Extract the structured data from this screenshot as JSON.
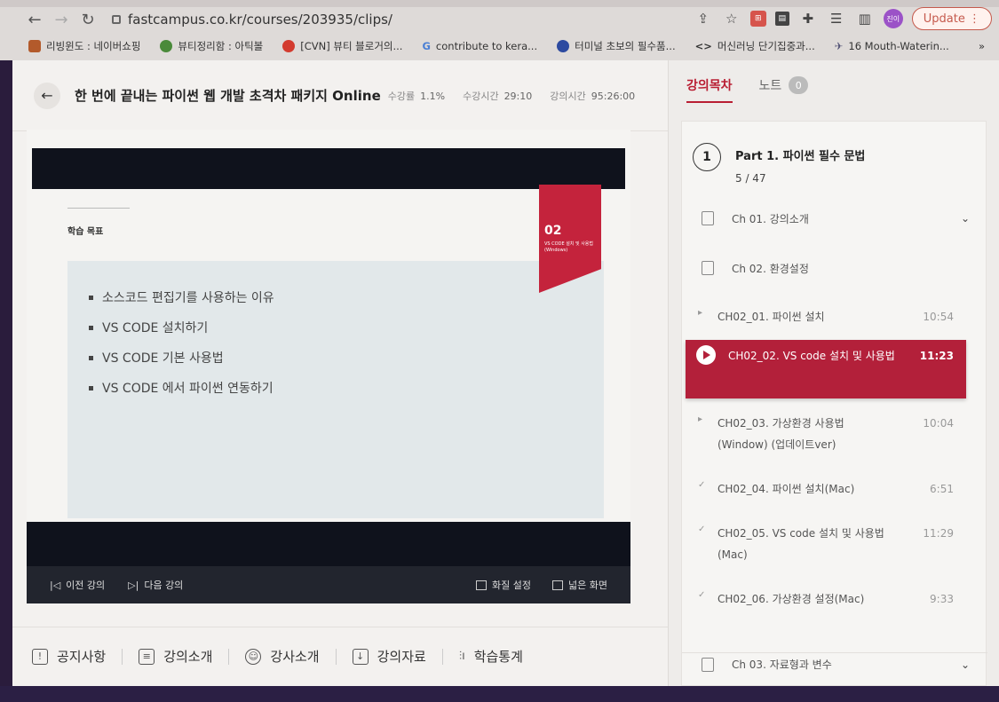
{
  "browser": {
    "url": "fastcampus.co.kr/courses/203935/clips/",
    "update_label": "Update",
    "profile_label": "진이",
    "bookmarks": [
      {
        "label": "리빙윈도 : 네이버쇼핑",
        "color": "#b35a2b"
      },
      {
        "label": "뷰티정리함 : 아틱볼",
        "color": "#4a8a3a"
      },
      {
        "label": "[CVN] 뷰티 블로거의...",
        "color": "#d33b2f"
      },
      {
        "label": "contribute to kera...",
        "color": "#4a7fd4"
      },
      {
        "label": "터미널 초보의 필수품...",
        "color": "#2d4aa0"
      },
      {
        "label": "머신러닝 단기집중과...",
        "color": "#444444"
      },
      {
        "label": "16 Mouth-Waterin...",
        "color": "#555577"
      }
    ]
  },
  "course": {
    "title": "한 번에 끝내는 파이썬 웹 개발 초격차 패키지 Online",
    "progress_label": "수강률",
    "progress_value": "1.1%",
    "watched_label": "수강시간",
    "watched_value": "29:10",
    "total_label": "강의시간",
    "total_value": "95:26:00"
  },
  "slide": {
    "goal_label": "학습 목표",
    "ribbon_num": "02",
    "ribbon_sub": "VS CODE 설치 및 사용법 (Windows)",
    "bullets": [
      "소스코드 편집기를 사용하는 이유",
      "VS CODE 설치하기",
      "VS CODE 기본 사용법",
      "VS CODE 에서 파이썬 연동하기"
    ]
  },
  "controls": {
    "prev": "이전 강의",
    "next": "다음 강의",
    "quality": "화질 설정",
    "wide": "넓은 화면"
  },
  "bottom_tabs": [
    "공지사항",
    "강의소개",
    "강사소개",
    "강의자료",
    "학습통계"
  ],
  "sidebar": {
    "tab_toc": "강의목차",
    "tab_notes": "노트",
    "notes_count": "0",
    "part_number": "1",
    "part_title": "Part 1. 파이썬 필수 문법",
    "part_progress": "5 / 47",
    "chapters": [
      "Ch 01. 강의소개",
      "Ch 02. 환경설정",
      "Ch 03. 자료형과 변수"
    ],
    "lectures": [
      {
        "name": "CH02_01. 파이썬 설치",
        "duration": "10:54"
      },
      {
        "name": "CH02_02. VS code 설치 및 사용법",
        "duration": "11:23"
      },
      {
        "name": "CH02_03. 가상환경 사용법 (Window) (업데이트ver)",
        "duration": "10:04"
      },
      {
        "name": "CH02_04. 파이썬 설치(Mac)",
        "duration": "6:51"
      },
      {
        "name": "CH02_05. VS code 설치 및 사용법(Mac)",
        "duration": "11:29"
      },
      {
        "name": "CH02_06. 가상환경 설정(Mac)",
        "duration": "9:33"
      }
    ]
  }
}
